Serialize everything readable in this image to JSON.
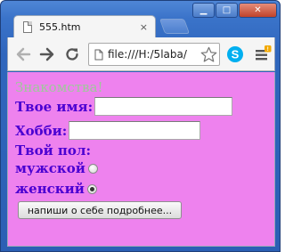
{
  "browser": {
    "tab_title": "555.htm",
    "tab_close": "×",
    "url": "file:///H:/5laba/",
    "window_controls": {
      "minimize": "▁",
      "maximize": "□",
      "close": "✕"
    },
    "icons": [
      "page-icon",
      "back-arrow-icon",
      "forward-arrow-icon",
      "reload-icon",
      "star-icon",
      "skype-icon",
      "menu-icon"
    ],
    "colors": {
      "frame": "#3a73c9",
      "close_button": "#c0432b",
      "skype": "#00aff0",
      "menu_badge": "#f2a900"
    }
  },
  "form": {
    "heading": "Знакомства!",
    "name_label": "Твое имя:",
    "name_value": "",
    "hobby_label": "Хобби:",
    "hobby_value": "",
    "gender_label": "Твой пол:",
    "male_label": "мужской",
    "male_checked": false,
    "female_label": "женский",
    "female_checked": true,
    "more_button": "напиши о себе подробнее...",
    "colors": {
      "background": "#ee82ee",
      "text": "#4b00d2",
      "heading": "#9ec89a"
    }
  }
}
